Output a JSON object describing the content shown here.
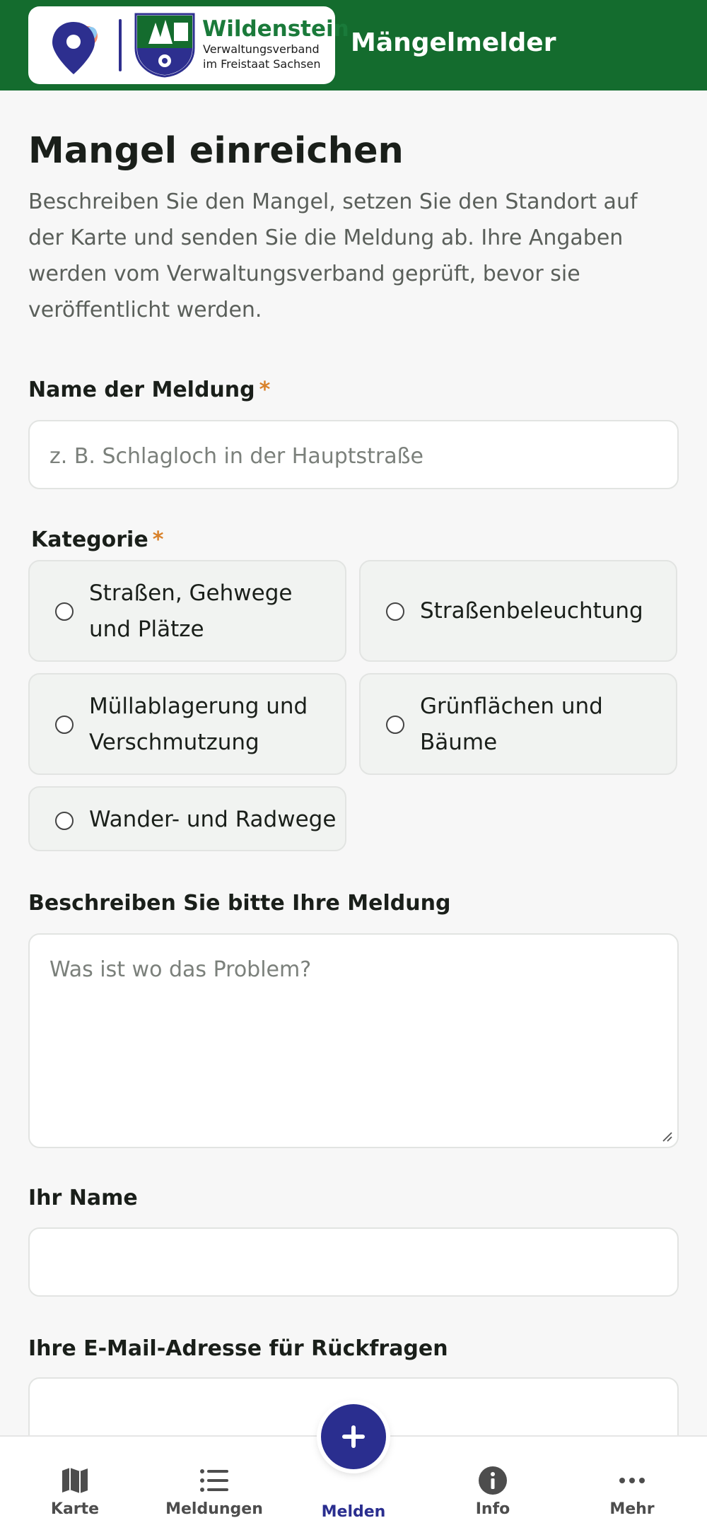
{
  "header": {
    "brand_name": "Wildenstein",
    "brand_sub_1": "Verwaltungsverband",
    "brand_sub_2": "im Freistaat Sachsen",
    "app_title": "Mängelmelder"
  },
  "form": {
    "title": "Mangel einreichen",
    "intro": "Beschreiben Sie den Mangel, setzen Sie den Standort auf der Karte und senden Sie die Meldung ab. Ihre Angaben werden vom Verwaltungsverband geprüft, bevor sie veröffentlicht werden.",
    "name_label": "Name der Meldung",
    "required_mark": "*",
    "name_placeholder": "z. B. Schlagloch in der Hauptstraße",
    "category_label": "Kategorie",
    "categories": [
      {
        "label": "Straßen, Gehwege und Plätze"
      },
      {
        "label": "Straßenbeleuchtung"
      },
      {
        "label": "Müllablagerung und Verschmutzung"
      },
      {
        "label": "Grünflächen und Bäume"
      },
      {
        "label": "Wander- und Radwege"
      }
    ],
    "description_label": "Beschreiben Sie bitte Ihre Meldung",
    "description_placeholder": "Was ist wo das Problem?",
    "your_name_label": "Ihr Name",
    "email_label": "Ihre E-Mail-Adresse für Rückfragen"
  },
  "nav": {
    "items": [
      {
        "label": "Karte",
        "icon": "map-icon"
      },
      {
        "label": "Meldungen",
        "icon": "list-icon"
      },
      {
        "label": "Melden",
        "icon": "plus-icon"
      },
      {
        "label": "Info",
        "icon": "info-icon"
      },
      {
        "label": "Mehr",
        "icon": "more-icon"
      }
    ]
  },
  "colors": {
    "header_bg": "#146c2e",
    "accent": "#2a2e8f",
    "required": "#d9822b"
  }
}
